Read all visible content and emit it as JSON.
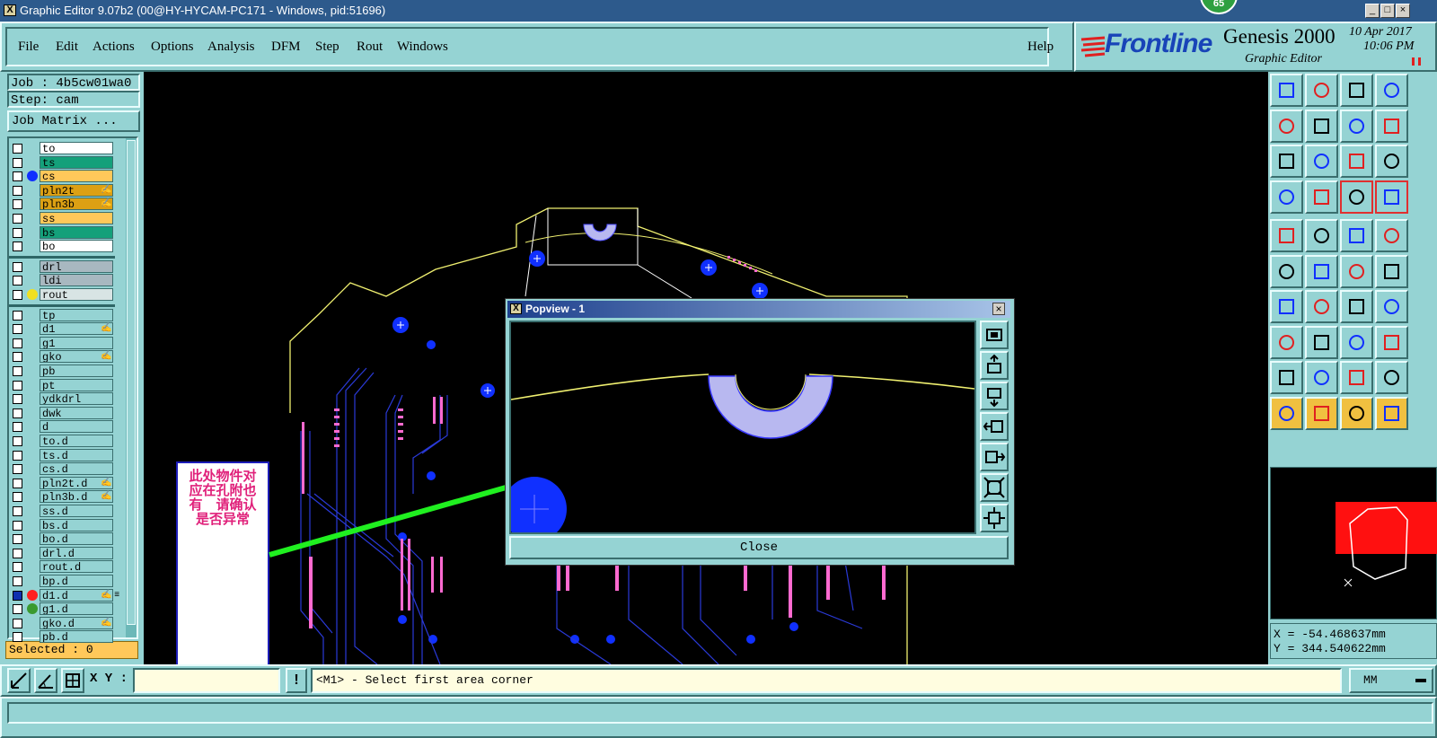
{
  "window": {
    "title": "Graphic Editor 9.07b2 (00@HY-HYCAM-PC171 - Windows, pid:51696)",
    "badge": "65",
    "min_label": "_",
    "max_label": "□",
    "close_label": "×"
  },
  "menu": {
    "items": [
      "File",
      "Edit",
      "Actions",
      "Options",
      "Analysis",
      "DFM",
      "Step",
      "Rout",
      "Windows"
    ],
    "help": "Help"
  },
  "brand": {
    "logo": "Frontline",
    "product": "Genesis 2000",
    "subtitle": "Graphic Editor",
    "date": "10 Apr 2017",
    "time": "10:06 PM"
  },
  "job": {
    "job_line": "Job : 4b5cw01wa0",
    "step_line": "Step: cam",
    "matrix_button": "Job Matrix ..."
  },
  "layers": {
    "group1": [
      {
        "name": "to",
        "color": "#ffffff",
        "dot": ""
      },
      {
        "name": "ts",
        "color": "#14a07a",
        "dot": ""
      },
      {
        "name": "cs",
        "color": "#ffc85a",
        "dot": "#1030ff"
      },
      {
        "name": "pln2t",
        "color": "#dca014",
        "dot": "",
        "mark": "✍"
      },
      {
        "name": "pln3b",
        "color": "#dca014",
        "dot": "",
        "mark": "✍"
      },
      {
        "name": "ss",
        "color": "#ffc85a",
        "dot": ""
      },
      {
        "name": "bs",
        "color": "#14a07a",
        "dot": ""
      },
      {
        "name": "bo",
        "color": "#ffffff",
        "dot": ""
      }
    ],
    "group2": [
      {
        "name": "drl",
        "color": "#a8b8c0",
        "dot": ""
      },
      {
        "name": "ldi",
        "color": "#a8b8c0",
        "dot": ""
      },
      {
        "name": "rout",
        "color": "#d8e4e4",
        "dot": "#f0e020"
      }
    ],
    "group3": [
      {
        "name": "tp",
        "color": "#95d3d3",
        "dot": ""
      },
      {
        "name": "d1",
        "color": "#95d3d3",
        "dot": "",
        "mark": "✍"
      },
      {
        "name": "g1",
        "color": "#95d3d3",
        "dot": ""
      },
      {
        "name": "gko",
        "color": "#95d3d3",
        "dot": "",
        "mark": "✍"
      },
      {
        "name": "pb",
        "color": "#95d3d3",
        "dot": ""
      },
      {
        "name": "pt",
        "color": "#95d3d3",
        "dot": ""
      },
      {
        "name": "ydkdrl",
        "color": "#95d3d3",
        "dot": ""
      },
      {
        "name": "dwk",
        "color": "#95d3d3",
        "dot": ""
      },
      {
        "name": "d",
        "color": "#95d3d3",
        "dot": ""
      },
      {
        "name": "to.d",
        "color": "#95d3d3",
        "dot": ""
      },
      {
        "name": "ts.d",
        "color": "#95d3d3",
        "dot": ""
      },
      {
        "name": "cs.d",
        "color": "#95d3d3",
        "dot": ""
      },
      {
        "name": "pln2t.d",
        "color": "#95d3d3",
        "dot": "",
        "mark": "✍"
      },
      {
        "name": "pln3b.d",
        "color": "#95d3d3",
        "dot": "",
        "mark": "✍"
      },
      {
        "name": "ss.d",
        "color": "#95d3d3",
        "dot": ""
      },
      {
        "name": "bs.d",
        "color": "#95d3d3",
        "dot": ""
      },
      {
        "name": "bo.d",
        "color": "#95d3d3",
        "dot": ""
      },
      {
        "name": "drl.d",
        "color": "#95d3d3",
        "dot": ""
      },
      {
        "name": "rout.d",
        "color": "#95d3d3",
        "dot": ""
      },
      {
        "name": "bp.d",
        "color": "#95d3d3",
        "dot": ""
      },
      {
        "name": "d1.d",
        "color": "#95d3d3",
        "dot": "#ff2020",
        "mark": "✍ ≡"
      },
      {
        "name": "g1.d",
        "color": "#95d3d3",
        "dot": "#3a9a30"
      },
      {
        "name": "gko.d",
        "color": "#95d3d3",
        "dot": "",
        "mark": "✍"
      },
      {
        "name": "pb.d",
        "color": "#95d3d3",
        "dot": ""
      }
    ],
    "selected": "Selected : 0"
  },
  "annotation": {
    "text": "此处物件对应在孔附也有　请确认是否异常"
  },
  "popview": {
    "title": "Popview - 1",
    "close_label": "Close"
  },
  "coords": {
    "x": "X = -54.468637mm",
    "y": "Y = 344.540622mm"
  },
  "bottom": {
    "xy_label": "X Y :",
    "xy_value": "",
    "bang": "!",
    "prompt": "<M1> - Select first area corner",
    "units": "MM"
  },
  "icons": {
    "left_tools": [
      "snap-icon",
      "angle-icon",
      "grid-icon"
    ],
    "pop_tools": [
      "zoom-home-icon",
      "zoom-in-icon",
      "zoom-out-icon",
      "pan-left-icon",
      "pan-right-icon",
      "fit-icon",
      "zoom-area-icon"
    ]
  }
}
